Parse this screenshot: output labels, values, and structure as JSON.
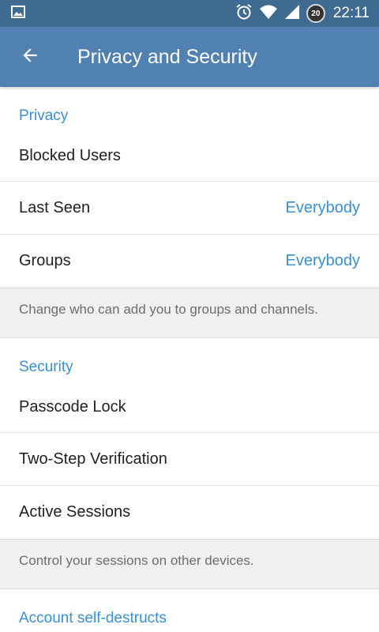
{
  "status_bar": {
    "time": "22:11",
    "battery_level": "20",
    "icons": [
      "image-icon",
      "alarm-icon",
      "wifi-icon",
      "signal-icon",
      "battery-icon"
    ]
  },
  "app_bar": {
    "title": "Privacy and Security",
    "back_icon": "arrow-back-icon"
  },
  "privacy": {
    "header": "Privacy",
    "items": [
      {
        "label": "Blocked Users",
        "value": ""
      },
      {
        "label": "Last Seen",
        "value": "Everybody"
      },
      {
        "label": "Groups",
        "value": "Everybody"
      }
    ],
    "hint": "Change who can add you to groups and channels."
  },
  "security": {
    "header": "Security",
    "items": [
      {
        "label": "Passcode Lock"
      },
      {
        "label": "Two-Step Verification"
      },
      {
        "label": "Active Sessions"
      }
    ],
    "hint": "Control your sessions on other devices."
  },
  "account": {
    "header": "Account self-destructs"
  },
  "colors": {
    "status_bar": "#3f6a91",
    "app_bar": "#5181b0",
    "accent": "#3a8fd0",
    "hint_bg": "#f0f0f0"
  }
}
